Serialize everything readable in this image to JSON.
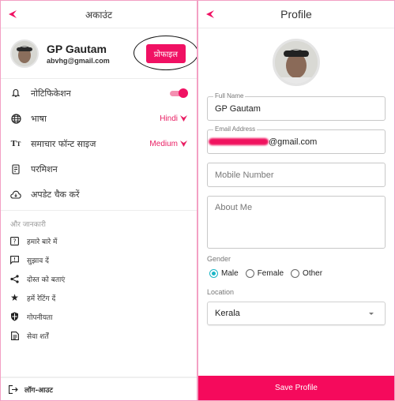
{
  "colors": {
    "accent": "#f01163",
    "radio_selected": "#1cb6c6",
    "frame": "#f3a0c4"
  },
  "account_screen": {
    "title": "अकाउंट",
    "back_icon": "back-arrow-icon",
    "user": {
      "name": "GP Gautam",
      "email": "abvhg@gmail.com"
    },
    "profile_button": "प्रोफाइल",
    "settings": [
      {
        "icon": "bell-icon",
        "label": "नोटिफिकेशन",
        "toggle_on": true
      },
      {
        "icon": "globe-icon",
        "label": "भाषा",
        "value": "Hindi"
      },
      {
        "icon": "font-size-icon",
        "label": "समाचार फॉन्ट साइज",
        "value": "Medium"
      },
      {
        "icon": "permission-icon",
        "label": "परमिशन"
      },
      {
        "icon": "cloud-download-icon",
        "label": "अपडेट चैक करें"
      }
    ],
    "more_info_header": "और जानकारी",
    "more_info": [
      {
        "icon": "help-icon",
        "label": "हमारे बारे में"
      },
      {
        "icon": "feedback-icon",
        "label": "सुझाव दें"
      },
      {
        "icon": "share-icon",
        "label": "दोस्त को बताएं"
      },
      {
        "icon": "star-icon",
        "label": "हमें रेटिंग दें"
      },
      {
        "icon": "shield-icon",
        "label": "गोपनीयता"
      },
      {
        "icon": "document-icon",
        "label": "सेवा शर्तें"
      }
    ],
    "logout": {
      "icon": "logout-icon",
      "label": "लॉग-आउट"
    }
  },
  "profile_screen": {
    "title": "Profile",
    "back_icon": "back-arrow-icon",
    "full_name": {
      "label": "Full Name",
      "value": "GP Gautam"
    },
    "email": {
      "label": "Email Address",
      "value_visible_suffix": "@gmail.com"
    },
    "mobile": {
      "placeholder": "Mobile Number",
      "value": ""
    },
    "about": {
      "placeholder": "About Me",
      "value": ""
    },
    "gender": {
      "label": "Gender",
      "options": [
        "Male",
        "Female",
        "Other"
      ],
      "selected": "Male"
    },
    "location": {
      "label": "Location",
      "value": "Kerala"
    },
    "save_button": "Save Profile"
  }
}
